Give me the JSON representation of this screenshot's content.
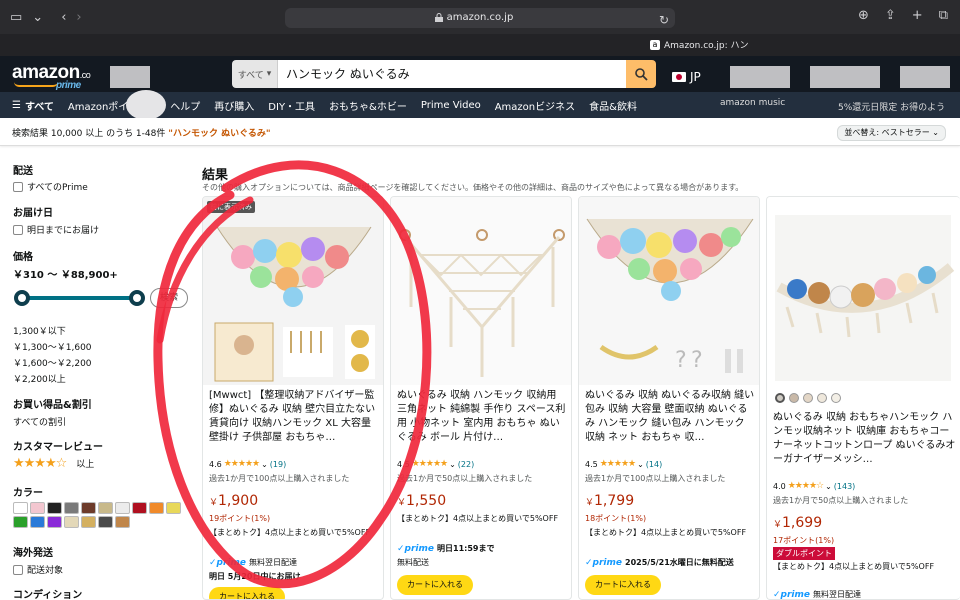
{
  "browser": {
    "url": "amazon.co.jp",
    "tab_title": "Amazon.co.jp: ハン"
  },
  "header": {
    "logo_text": "amazon",
    "logo_suffix": ".co",
    "logo_prime": "prime",
    "search_category": "すべて",
    "search_query": "ハンモック ぬいぐるみ",
    "lang": "JP"
  },
  "nav": {
    "all_label": "すべて",
    "items": [
      "Amazonポイ",
      "ヘルプ",
      "再び購入",
      "DIY・工具",
      "おもちゃ&ホビー",
      "Prime Video",
      "Amazonビジネス",
      "食品&飲料"
    ],
    "promo": "amazon music",
    "promo2": "5%還元日限定 お得のよう"
  },
  "results_bar": {
    "text": "検索結果 10,000 以上 のうち 1-48件",
    "query": "\"ハンモック ぬいぐるみ\"",
    "sort": "並べ替え: ベストセラー"
  },
  "sidebar": {
    "delivery_h": "配送",
    "prime": "すべてのPrime",
    "date_h": "お届け日",
    "tomorrow": "明日までにお届け",
    "price_h": "価格",
    "price_range": "￥310 〜 ￥88,900+",
    "search_btn": "検索",
    "price_opts": [
      "1,300￥以下",
      "￥1,300〜￥1,600",
      "￥1,600〜￥2,200",
      "￥2,200以上"
    ],
    "discount_h": "お買い得品&割引",
    "all_discount": "すべての割引",
    "review_h": "カスタマーレビュー",
    "review_up": "以上",
    "color_h": "カラー",
    "colors": [
      "#ffffff",
      "#f3c7d0",
      "#222222",
      "#7a7a7a",
      "#6d3b2a",
      "#c8b98a",
      "#ececec",
      "#b01020",
      "#f08a2a",
      "#e8d85a",
      "#2aa02a",
      "#2a7ad8",
      "#8a2ad8",
      "#e3d8b8",
      "#d4b060",
      "#4a4a4a",
      "#c0864a"
    ],
    "overseas_h": "海外発送",
    "overseas": "配送対象",
    "condition_h": "コンディション"
  },
  "results": {
    "title": "結果",
    "subtitle": "その他の購入オプションについては、商品詳細ページを確認してください。価格やその他の詳細は、商品のサイズや色によって異なる場合があります。"
  },
  "products": [
    {
      "badge": "前に表示済み",
      "title": "[Mwwct] 【整理収納アドバイザー監修】ぬいぐるみ 収納 壁穴目立たない 賃貸向け 収納ハンモック XL 大容量 壁掛け 子供部屋 おもちゃ…",
      "rating": "4.6",
      "stars": "★★★★★",
      "count": "(19)",
      "bought": "過去1か月で100点以上購入されました",
      "price": "1,900",
      "points": "19ポイント(1%)",
      "deal": "【まとめトク】4点以上まとめ買いで5%OFF",
      "prime_text": "無料翌日配達",
      "delivery": "明日 5月20日中にお届け",
      "cart": "カートに入れる"
    },
    {
      "title": "ぬいぐるみ 収納 ハンモック 収納用 三角ネット 純綿製 手作り スペース利用 小物ネット 室内用 おもちゃ ぬいぐるみ ボール 片付け…",
      "rating": "4.5",
      "stars": "★★★★★",
      "count": "(22)",
      "bought": "過去1か月で50点以上購入されました",
      "price": "1,550",
      "points": "",
      "deal": "【まとめトク】4点以上まとめ買いで5%OFF",
      "prime_text": "明日11:59まで",
      "delivery": "無料配送",
      "cart": "カートに入れる"
    },
    {
      "title": "ぬいぐるみ 収納 ぬいぐるみ収納 縫い包み 収納 大容量 壁面収納 ぬいぐるみ ハンモック 縫い包み ハンモック 収納 ネット おもちゃ 収…",
      "rating": "4.5",
      "stars": "★★★★★",
      "count": "(14)",
      "bought": "過去1か月で100点以上購入されました",
      "price": "1,799",
      "points": "18ポイント(1%)",
      "deal": "【まとめトク】4点以上まとめ買いで5%OFF",
      "prime_text": "2025/5/21水曜日に無料配送",
      "delivery": "",
      "cart": "カートに入れる"
    },
    {
      "title": "ぬいぐるみ 収納 おもちゃハンモック ハンモッ収納ネット 収納庫 おもちゃコーナーネットコットンロープ ぬいぐるみオーガナイザーメッシ…",
      "rating": "4.0",
      "stars": "★★★★☆",
      "count": "(143)",
      "bought": "過去1か月で50点以上購入されました",
      "price": "1,699",
      "points": "17ポイント(1%)",
      "double": "ダブルポイント",
      "deal": "【まとめトク】4点以上まとめ買いで5%OFF",
      "prime_text": "無料翌日配達",
      "delivery": "",
      "cart": ""
    }
  ]
}
